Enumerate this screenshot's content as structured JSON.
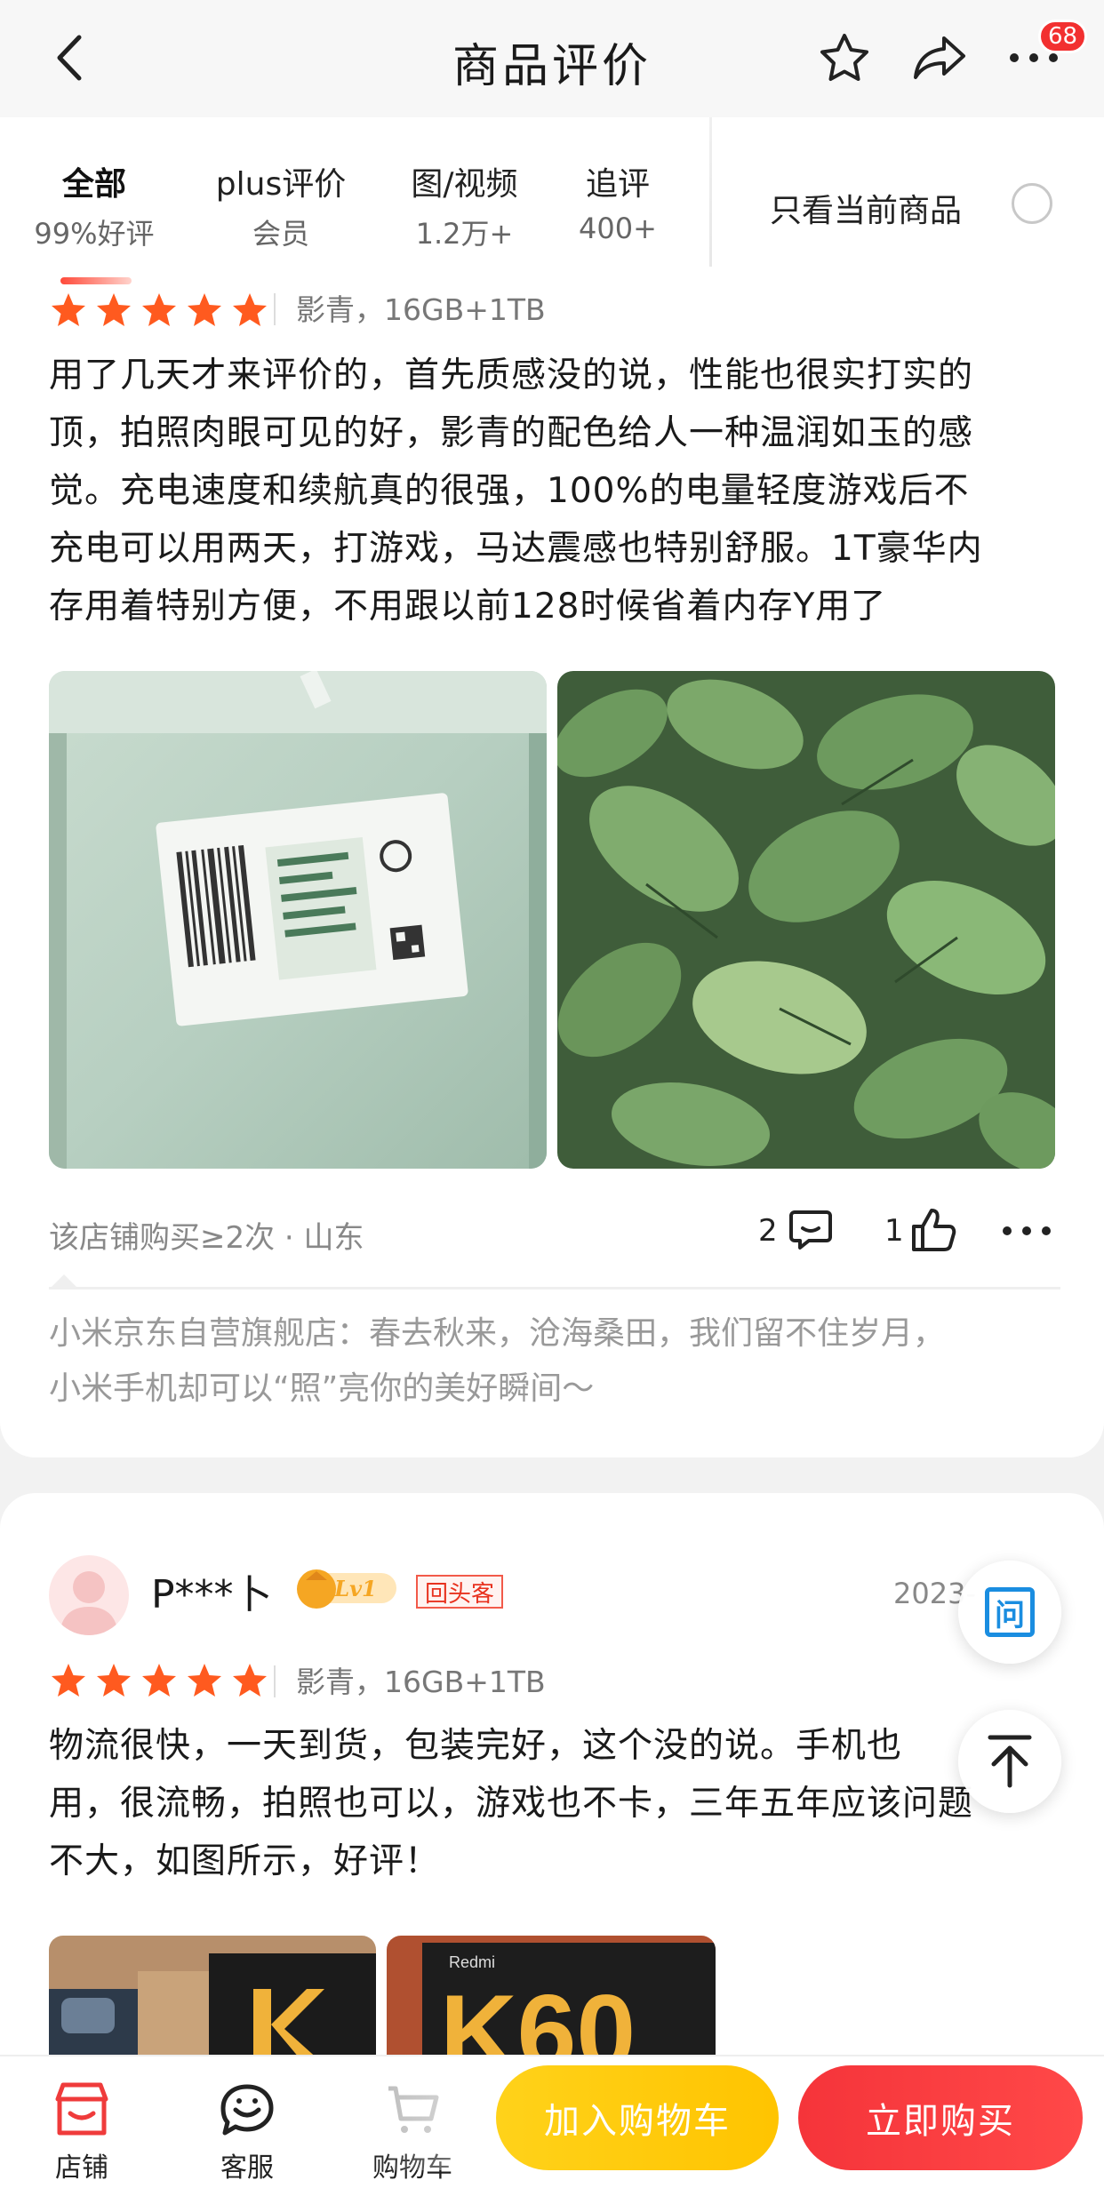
{
  "header": {
    "title": "商品评价",
    "badge_count": "68"
  },
  "tabs": [
    {
      "label": "全部",
      "sub": "99%好评"
    },
    {
      "label": "plus评价",
      "sub": "会员"
    },
    {
      "label": "图/视频",
      "sub": "1.2万+"
    },
    {
      "label": "追评",
      "sub": "400+"
    }
  ],
  "filter": {
    "only_current_label": "只看当前商品"
  },
  "review1": {
    "rating": 5,
    "variant": "影青，16GB+1TB",
    "text_lines": [
      "用了几天才来评价的，首先质感没的说，性能也很实打实的",
      "顶，拍照肉眼可见的好，影青的配色给人一种温润如玉的感",
      "觉。充电速度和续航真的很强，100%的电量轻度游戏后不",
      "充电可以用两天，打游戏，马达震感也特别舒服。1T豪华内",
      "存用着特别方便，不用跟以前128时候省着内存Y用了"
    ],
    "meta": "该店铺购买≥2次 · 山东",
    "comment_count": "2",
    "like_count": "1",
    "store_reply_lines": [
      "小米京东自营旗舰店：春去秋来，沧海桑田，我们留不住岁月，",
      "小米手机却可以“照”亮你的美好瞬间～"
    ]
  },
  "review2": {
    "username": "P***卜",
    "level_badge": "Lv1",
    "repeat_tag": "回头客",
    "date": "2023-",
    "rating": 5,
    "variant": "影青，16GB+1TB",
    "text_lines": [
      "物流很快，一天到货，包装完好，这个没的说。手机也",
      "用，很流畅，拍照也可以，游戏也不卡，三年五年应该问题",
      "不大，如图所示，好评！"
    ],
    "photo2_brand": "Redmi",
    "photo2_model": "K60"
  },
  "fab": {
    "ask_label": "问"
  },
  "bottom": {
    "shop": "店铺",
    "service": "客服",
    "cart": "购物车",
    "add_cart": "加入购物车",
    "buy_now": "立即购买"
  },
  "colors": {
    "accent_red": "#f23030",
    "star_orange": "#ff5a1f",
    "cart_yellow": "#ffc400"
  }
}
